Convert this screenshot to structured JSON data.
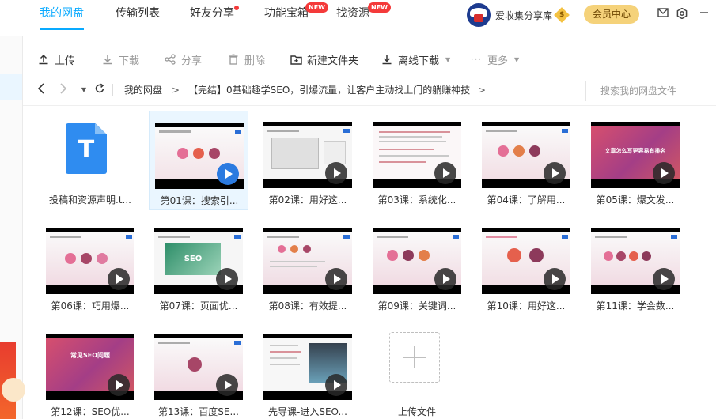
{
  "nav": {
    "tabs": [
      {
        "label": "我的网盘"
      },
      {
        "label": "传输列表"
      },
      {
        "label": "好友分享"
      },
      {
        "label": "功能宝箱"
      },
      {
        "label": "找资源"
      }
    ],
    "new_badge": "NEW"
  },
  "user": {
    "name": "爱收集分享库",
    "vip_symbol": "$",
    "member_center": "会员中心"
  },
  "toolbar": {
    "upload": "上传",
    "download": "下载",
    "share": "分享",
    "delete": "删除",
    "new_folder": "新建文件夹",
    "offline_download": "离线下载",
    "more": "更多"
  },
  "breadcrumb": {
    "root": "我的网盘",
    "sep": ">",
    "folder": "【完结】0基础趣学SEO，引爆流量，让客户主动找上门的躺赚神技",
    "trail": ">",
    "search_placeholder": "搜索我的网盘文件"
  },
  "files": [
    {
      "name": "投稿和资源声明.t...",
      "type": "doc",
      "icon_letter": "T"
    },
    {
      "name": "第01课：搜索引...",
      "type": "video",
      "selected": true
    },
    {
      "name": "第02课：用好这...",
      "type": "video"
    },
    {
      "name": "第03课：系统化...",
      "type": "video"
    },
    {
      "name": "第04课：了解用...",
      "type": "video"
    },
    {
      "name": "第05课：爆文发...",
      "type": "video",
      "slide_text": "文章怎么写更容易有排名"
    },
    {
      "name": "第06课：巧用爆...",
      "type": "video"
    },
    {
      "name": "第07课：页面优...",
      "type": "video",
      "slide_text": "SEO"
    },
    {
      "name": "第08课：有效提...",
      "type": "video"
    },
    {
      "name": "第09课：关键词...",
      "type": "video"
    },
    {
      "name": "第10课：用好这...",
      "type": "video"
    },
    {
      "name": "第11课：学会数...",
      "type": "video"
    },
    {
      "name": "第12课：SEO优...",
      "type": "video",
      "slide_text": "常见SEO问题"
    },
    {
      "name": "第13课：百度SE...",
      "type": "video"
    },
    {
      "name": "先导课-进入SEO...",
      "type": "video"
    },
    {
      "name": "上传文件",
      "type": "upload"
    }
  ],
  "colors": {
    "accent": "#09aaff",
    "badge": "#f43a3a",
    "member": "#f5d27a"
  }
}
